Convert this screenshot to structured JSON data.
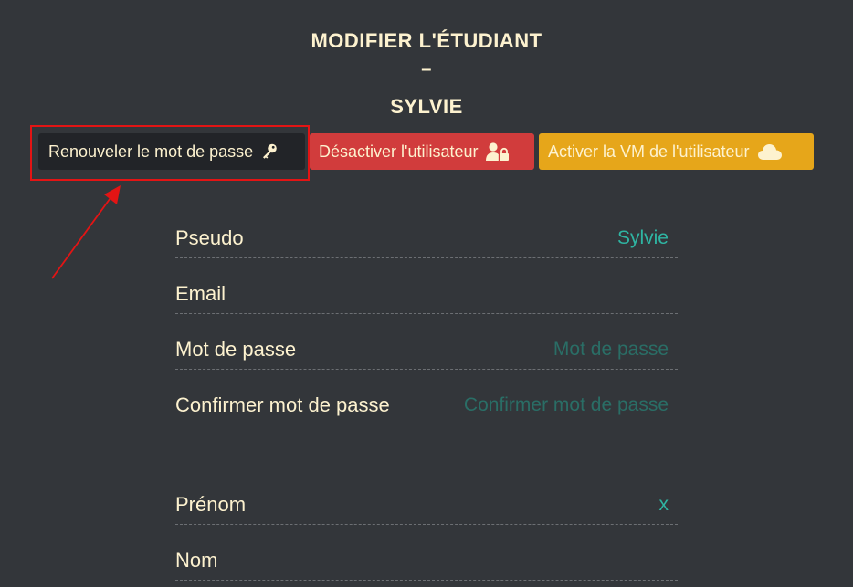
{
  "header": {
    "title": "MODIFIER L'ÉTUDIANT",
    "separator": "–",
    "student_name": "SYLVIE"
  },
  "actions": {
    "renew_password": "Renouveler le mot de passe",
    "disable_user": "Désactiver l'utilisateur",
    "activate_vm": "Activer la VM de l'utilisateur"
  },
  "form": {
    "pseudo": {
      "label": "Pseudo",
      "value": "Sylvie",
      "placeholder": ""
    },
    "email": {
      "label": "Email",
      "value": "",
      "placeholder": ""
    },
    "password": {
      "label": "Mot de passe",
      "value": "",
      "placeholder": "Mot de passe"
    },
    "confirm_password": {
      "label": "Confirmer mot de passe",
      "value": "",
      "placeholder": "Confirmer mot de passe"
    },
    "first_name": {
      "label": "Prénom",
      "value": "x",
      "placeholder": ""
    },
    "last_name": {
      "label": "Nom",
      "value": "",
      "placeholder": ""
    }
  },
  "colors": {
    "background": "#33363a",
    "text": "#fdf2cf",
    "accent_teal": "#2fb5a3",
    "danger": "#d13c3c",
    "warning": "#e6a61a",
    "annotation": "#e31414"
  },
  "icons": {
    "renew": "key-icon",
    "disable": "user-lock-icon",
    "activate": "cloud-icon"
  }
}
